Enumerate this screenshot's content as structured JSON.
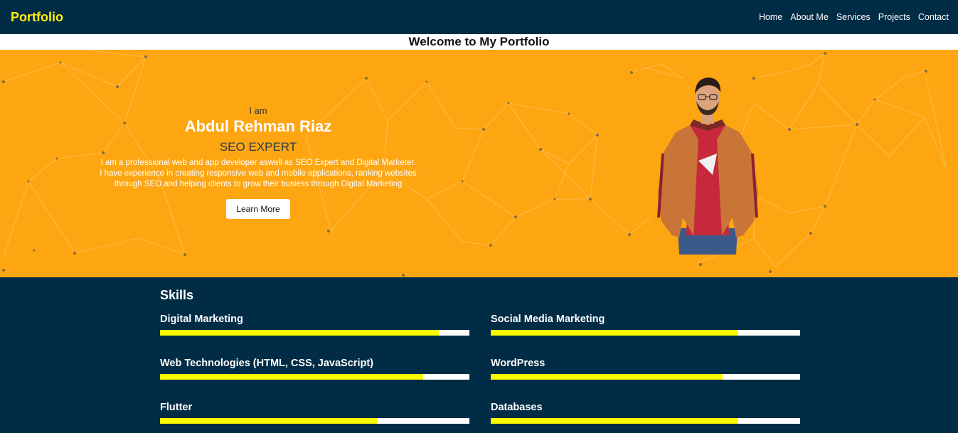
{
  "nav": {
    "brand": "Portfolio",
    "items": [
      "Home",
      "About Me",
      "Services",
      "Projects",
      "Contact"
    ]
  },
  "welcome": "Welcome to My Portfolio",
  "hero": {
    "iam": "I am",
    "name": "Abdul Rehman Riaz",
    "role": "SEO EXPERT",
    "desc_lines": [
      "I am a professional web and app developer aswell as SEO Expert and Digital Marketer.",
      "I have experience in creating responsive web and mobile applications, ranking websites",
      "through SEO and helping clients to grow their busiess through Digital Marketing"
    ],
    "button": "Learn More"
  },
  "skills": {
    "title": "Skills",
    "items": [
      {
        "label": "Digital Marketing",
        "level": 0.9
      },
      {
        "label": "Social Media Marketing",
        "level": 0.8
      },
      {
        "label": "Web Technologies (HTML, CSS, JavaScript)",
        "level": 0.85
      },
      {
        "label": "WordPress",
        "level": 0.75
      },
      {
        "label": "Flutter",
        "level": 0.7
      },
      {
        "label": "Databases",
        "level": 0.8
      }
    ]
  },
  "colors": {
    "nav_bg": "#002c46",
    "brand": "#fcee0a",
    "hero_bg": "#fea612",
    "bar_fill": "#f8fb00"
  }
}
